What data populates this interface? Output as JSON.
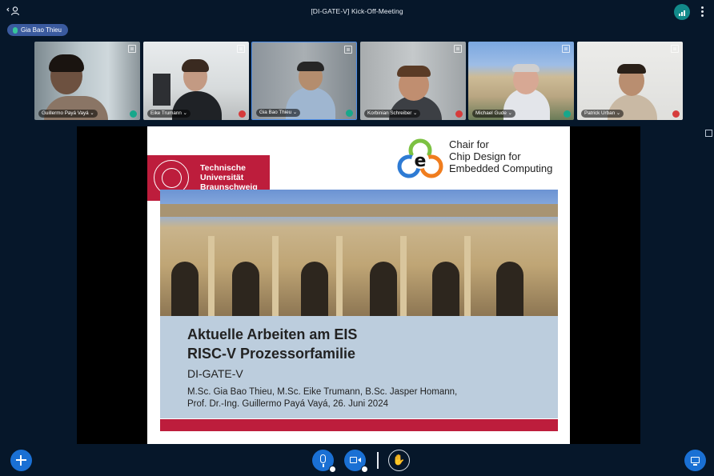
{
  "meeting": {
    "title": "[DI-GATE-V] Kick-Off-Meeting",
    "presenter_name": "Gia Bao Thieu"
  },
  "participants": [
    {
      "name": "Guillermo Payá Vayá",
      "audio": "on",
      "active": false
    },
    {
      "name": "Eike Trumann",
      "audio": "muted",
      "active": false
    },
    {
      "name": "Gia Bao Thieu",
      "audio": "on",
      "active": true
    },
    {
      "name": "Korbinian Schreiber",
      "audio": "muted",
      "active": false
    },
    {
      "name": "Michael Gude",
      "audio": "on",
      "active": false
    },
    {
      "name": "Patrick Urban",
      "audio": "muted",
      "active": false
    }
  ],
  "slide": {
    "university_logo_text": "Technische Universität Braunschweig",
    "chair": "Chair for Chip Design for Embedded Computing",
    "chair_line1": "Chair for",
    "chair_line2": "Chip Design for",
    "chair_line3": "Embedded Computing",
    "title_line1": "Aktuelle Arbeiten am EIS",
    "title_line2": "RISC-V Prozessorfamilie",
    "subtitle": "DI-GATE-V",
    "authors_line1": "M.Sc. Gia Bao Thieu, M.Sc. Eike Trumann, B.Sc. Jasper Homann,",
    "authors_line2": "Prof. Dr.-Ing. Guillermo Payá Vayá, 26. Juni 2024"
  },
  "colors": {
    "background": "#06172a",
    "accent_blue": "#1a70d4",
    "tu_red": "#bd1d3c",
    "audio_on": "#17a78b",
    "audio_muted": "#d63b3b",
    "signal": "#128a8a"
  },
  "icons": {
    "user": "user-icon",
    "signal": "connection-signal-icon",
    "menu": "kebab-menu-icon",
    "fullscreen": "fullscreen-icon",
    "plus": "plus-icon",
    "mic": "microphone-icon",
    "camera": "camera-icon",
    "hand": "raise-hand-icon",
    "screen": "screen-share-icon"
  }
}
